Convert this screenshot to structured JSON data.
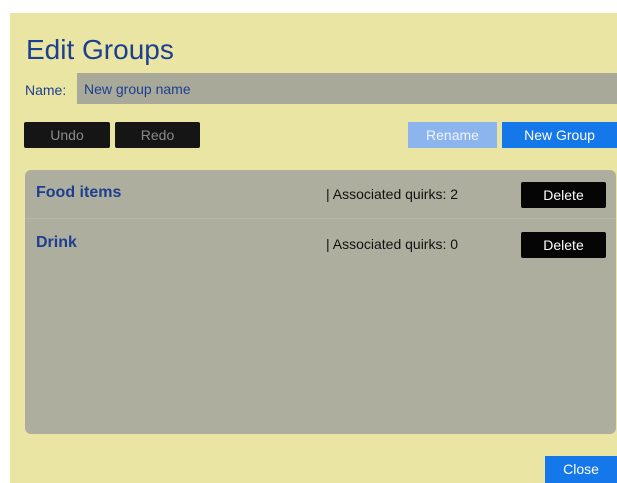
{
  "dialog": {
    "title": "Edit Groups",
    "name_label": "Name:",
    "name_placeholder": "New group name",
    "name_value": ""
  },
  "toolbar": {
    "undo_label": "Undo",
    "redo_label": "Redo",
    "rename_label": "Rename",
    "new_group_label": "New Group"
  },
  "groups": [
    {
      "name": "Food items",
      "quirks_text": "| Associated quirks: 2",
      "delete_label": "Delete"
    },
    {
      "name": "Drink",
      "quirks_text": "| Associated quirks: 0",
      "delete_label": "Delete"
    }
  ],
  "footer": {
    "close_label": "Close"
  },
  "colors": {
    "dialog_background": "#eae5a3",
    "panel_background": "#aeae9f",
    "accent_blue": "#1578ea",
    "title_blue": "#1c3f8f"
  }
}
